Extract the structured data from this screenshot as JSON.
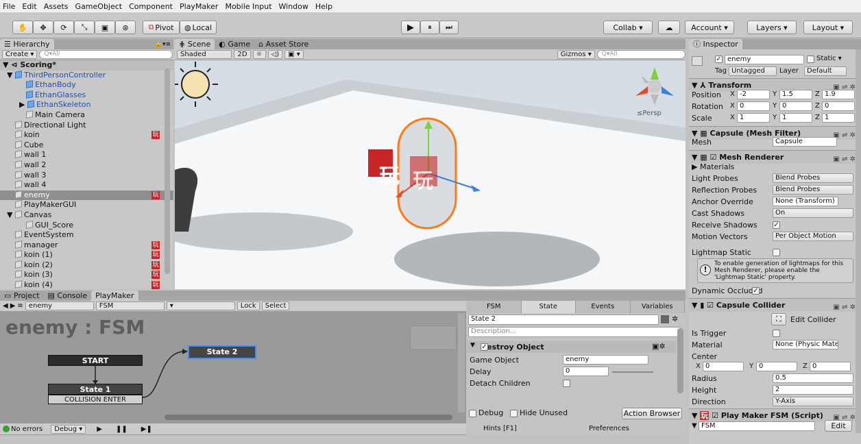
{
  "menu": [
    "File",
    "Edit",
    "Assets",
    "GameObject",
    "Component",
    "PlayMaker",
    "Mobile Input",
    "Window",
    "Help"
  ],
  "toolbar": {
    "tools": [
      "✋",
      "✥",
      "⟳",
      "⤡",
      "▣",
      "⊛"
    ],
    "pivot": "Pivot",
    "local": "Local",
    "play": "▶",
    "pause": "⏸",
    "step": "⏭",
    "collab": "Collab ▾",
    "cloud": "☁",
    "account": "Account ▾",
    "layers": "Layers ▾",
    "layout": "Layout ▾"
  },
  "hierarchy": {
    "tab": "Hierarchy",
    "create": "Create ▾",
    "search": "Q▾All",
    "scene": "Scoring*",
    "items": [
      "ThirdPersonController",
      "EthanBody",
      "EthanGlasses",
      "EthanSkeleton",
      "Main Camera",
      "Directional Light",
      "koin",
      "Cube",
      "wall 1",
      "wall 2",
      "wall 3",
      "wall 4",
      "enemy",
      "PlayMakerGUI",
      "Canvas",
      "GUI_Score",
      "EventSystem",
      "manager",
      "koin (1)",
      "koin (2)",
      "koin (3)",
      "koin (4)"
    ]
  },
  "scene": {
    "tabs": [
      "Scene",
      "Game",
      "Asset Store"
    ],
    "shaded": "Shaded",
    "twoD": "2D",
    "gizmos": "Gizmos ▾",
    "search": "Q▾All",
    "persp": "≤Persp",
    "pm_glyph": "玩"
  },
  "bottom": {
    "tabs": [
      "Project",
      "Console",
      "PlayMaker"
    ],
    "object": "enemy",
    "fsm": "FSM",
    "lock": "Lock",
    "select": "Select",
    "title": "enemy : FSM",
    "start": "START",
    "state1": "State 1",
    "event": "COLLISION ENTER",
    "state2": "State 2",
    "status": "No errors",
    "debug": "Debug ▾"
  },
  "fsm_panel": {
    "tabs": [
      "FSM",
      "State",
      "Events",
      "Variables"
    ],
    "state_name": "State 2",
    "description": "Description...",
    "action": "Destroy Object",
    "game_object_label": "Game Object",
    "game_object_value": "enemy",
    "delay_label": "Delay",
    "delay_value": "0",
    "detach_label": "Detach Children",
    "debug": "Debug",
    "hide_unused": "Hide Unused",
    "action_browser": "Action Browser",
    "hints": "Hints [F1]",
    "preferences": "Preferences"
  },
  "inspector": {
    "tab": "Inspector",
    "name": "enemy",
    "static": "Static ▾",
    "tag_label": "Tag",
    "tag": "Untagged",
    "layer_label": "Layer",
    "layer": "Default",
    "transform": "Transform",
    "position": "Position",
    "rotation": "Rotation",
    "scale": "Scale",
    "pos": [
      "-2",
      "1.5",
      "1.9"
    ],
    "rot": [
      "0",
      "0",
      "0"
    ],
    "scl": [
      "1",
      "1",
      "1"
    ],
    "mesh_filter": "Capsule (Mesh Filter)",
    "mesh_label": "Mesh",
    "mesh_value": "Capsule",
    "mesh_renderer": "Mesh Renderer",
    "materials": "Materials",
    "light_probes": "Light Probes",
    "light_probes_v": "Blend Probes",
    "reflection_probes": "Reflection Probes",
    "reflection_probes_v": "Blend Probes",
    "anchor": "Anchor Override",
    "anchor_v": "None (Transform)",
    "cast": "Cast Shadows",
    "cast_v": "On",
    "receive": "Receive Shadows",
    "motion": "Motion Vectors",
    "motion_v": "Per Object Motion",
    "lightmap": "Lightmap Static",
    "info": "To enable generation of lightmaps for this Mesh Renderer, please enable the 'Lightmap Static' property.",
    "dynamic": "Dynamic Occluded",
    "collider": "Capsule Collider",
    "edit_collider": "Edit Collider",
    "trigger": "Is Trigger",
    "material": "Material",
    "material_v": "None (Physic Material)",
    "center": "Center",
    "center_v": [
      "0",
      "0",
      "0"
    ],
    "radius": "Radius",
    "radius_v": "0.5",
    "height": "Height",
    "height_v": "2",
    "direction": "Direction",
    "direction_v": "Y-Axis",
    "pmfsm": "Play Maker FSM (Script)",
    "fsm_field": "FSM",
    "edit": "Edit"
  }
}
